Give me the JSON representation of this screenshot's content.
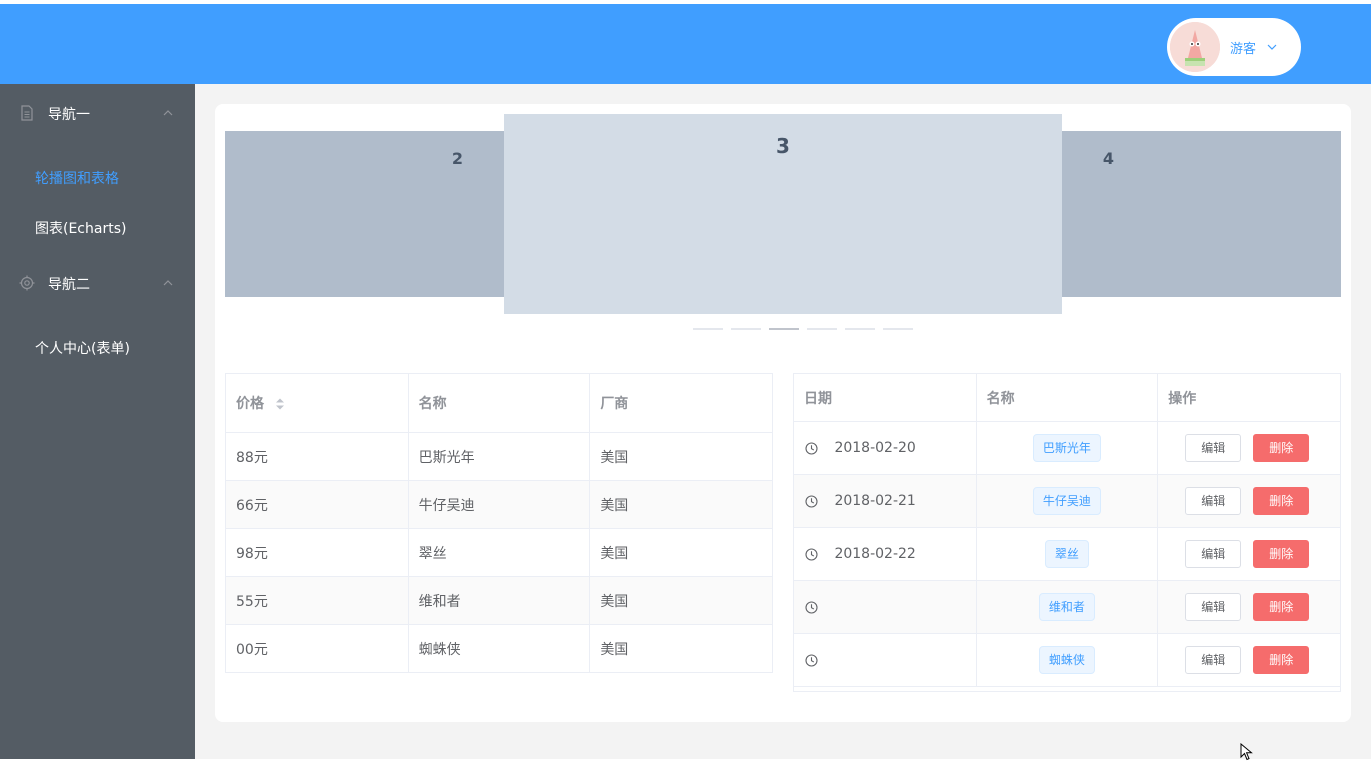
{
  "header": {
    "user_name": "游客",
    "avatar_icon": "patrick-star-avatar",
    "dropdown_icon": "chevron-down-icon",
    "bg_color": "#409eff"
  },
  "sidebar": {
    "bg_color": "#545c64",
    "active_color": "#409eff",
    "groups": [
      {
        "label": "导航一",
        "icon": "document-icon",
        "items": [
          {
            "label": "轮播图和表格",
            "active": true
          },
          {
            "label": "图表(Echarts)",
            "active": false
          }
        ]
      },
      {
        "label": "导航二",
        "icon": "gear-icon",
        "items": [
          {
            "label": "个人中心(表单)",
            "active": false
          }
        ]
      }
    ]
  },
  "carousel": {
    "slides": [
      "2",
      "3",
      "4"
    ],
    "indicator_count": 6,
    "active_indicator": 3
  },
  "table1": {
    "headers": [
      "价格",
      "名称",
      "厂商"
    ],
    "rows": [
      [
        "88元",
        "巴斯光年",
        "美国"
      ],
      [
        "66元",
        "牛仔吴迪",
        "美国"
      ],
      [
        "98元",
        "翠丝",
        "美国"
      ],
      [
        "55元",
        "维和者",
        "美国"
      ],
      [
        "00元",
        "蜘蛛侠",
        "美国"
      ]
    ]
  },
  "table2": {
    "headers": [
      "日期",
      "名称",
      "操作"
    ],
    "edit_label": "编辑",
    "delete_label": "删除",
    "rows": [
      {
        "date": "2018-02-20",
        "name": "巴斯光年"
      },
      {
        "date": "2018-02-21",
        "name": "牛仔吴迪"
      },
      {
        "date": "2018-02-22",
        "name": "翠丝"
      },
      {
        "date": "",
        "name": "维和者"
      },
      {
        "date": "",
        "name": "蜘蛛侠"
      }
    ]
  }
}
